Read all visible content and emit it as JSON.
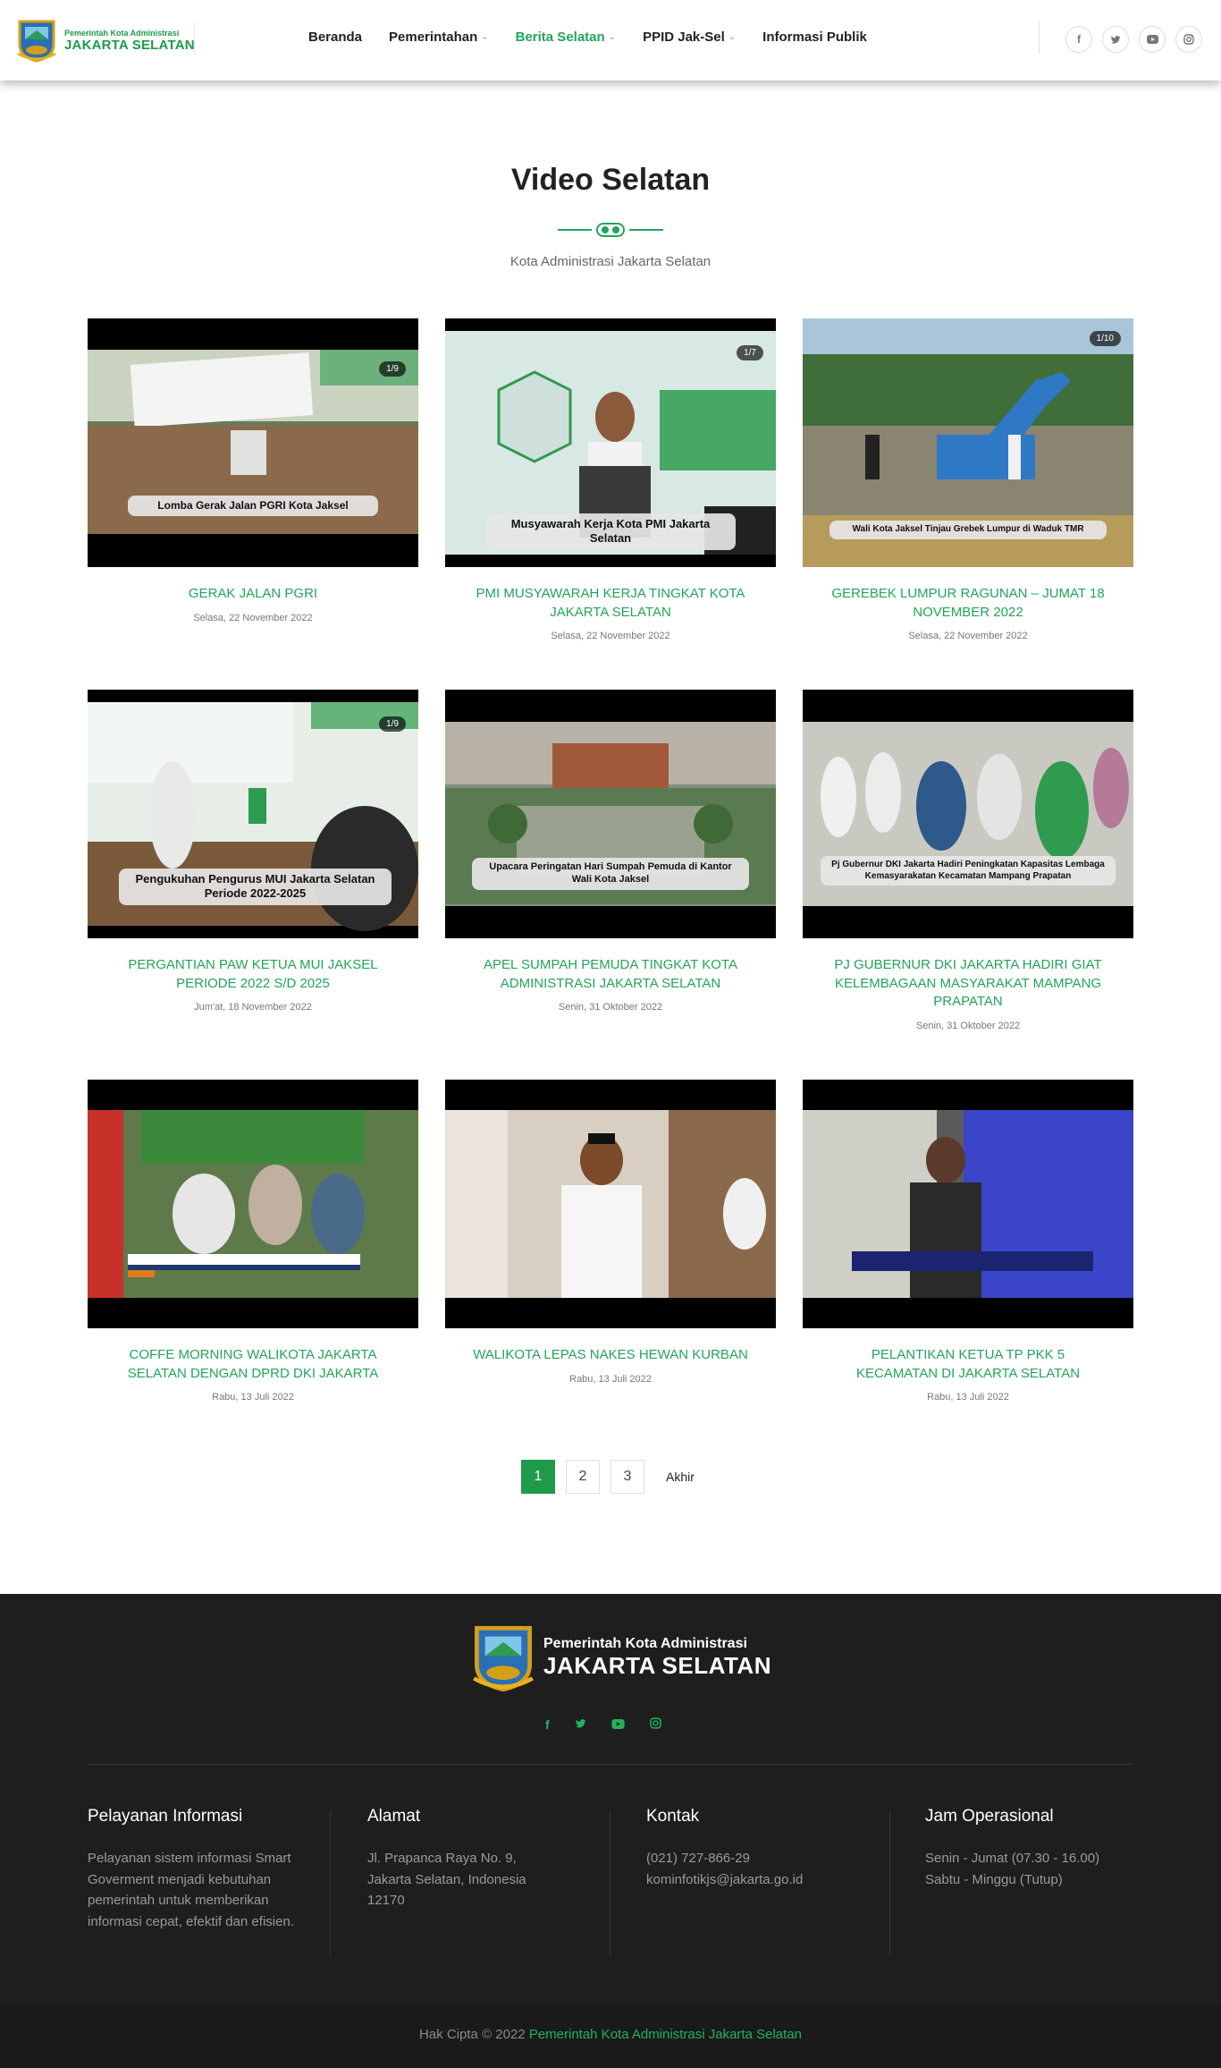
{
  "header": {
    "logo_small": "Pemerintah Kota Administrasi",
    "logo_big": "JAKARTA SELATAN",
    "nav": [
      {
        "label": "Beranda",
        "dropdown": false,
        "active": false
      },
      {
        "label": "Pemerintahan",
        "dropdown": true,
        "active": false
      },
      {
        "label": "Berita Selatan",
        "dropdown": true,
        "active": true
      },
      {
        "label": "PPID Jak-Sel",
        "dropdown": true,
        "active": false
      },
      {
        "label": "Informasi Publik",
        "dropdown": false,
        "active": false
      }
    ],
    "social_icons": [
      "facebook-icon",
      "twitter-icon",
      "youtube-icon",
      "instagram-icon"
    ]
  },
  "section": {
    "title": "Video Selatan",
    "subtitle": "Kota Administrasi Jakarta Selatan"
  },
  "videos": [
    {
      "title": "GERAK JALAN PGRI",
      "date": "Selasa, 22 November 2022",
      "overlay": "Lomba Gerak Jalan PGRI Kota Jaksel",
      "counter": "1/9"
    },
    {
      "title": "PMI MUSYAWARAH KERJA TINGKAT KOTA JAKARTA SELATAN",
      "date": "Selasa, 22 November 2022",
      "overlay": "Musyawarah Kerja Kota PMI Jakarta Selatan",
      "counter": "1/7"
    },
    {
      "title": "GEREBEK LUMPUR RAGUNAN – JUMAT 18 NOVEMBER 2022",
      "date": "Selasa, 22 November 2022",
      "overlay": "Wali Kota Jaksel Tinjau Grebek Lumpur di Waduk TMR",
      "counter": "1/10"
    },
    {
      "title": "PERGANTIAN PAW KETUA MUI JAKSEL PERIODE 2022 S/D 2025",
      "date": "Jum'at, 18 November 2022",
      "overlay": "Pengukuhan Pengurus MUI Jakarta Selatan Periode 2022-2025",
      "counter": "1/9"
    },
    {
      "title": "APEL SUMPAH PEMUDA TINGKAT KOTA ADMINISTRASI JAKARTA SELATAN",
      "date": "Senin, 31 Oktober 2022",
      "overlay": "Upacara Peringatan Hari Sumpah Pemuda di Kantor Wali Kota Jaksel",
      "counter": ""
    },
    {
      "title": "PJ GUBERNUR DKI JAKARTA HADIRI GIAT KELEMBAGAAN MASYARAKAT MAMPANG PRAPATAN",
      "date": "Senin, 31 Oktober 2022",
      "overlay": "Pj Gubernur DKI Jakarta Hadiri Peningkatan Kapasitas Lembaga Kemasyarakatan Kecamatan Mampang Prapatan",
      "counter": ""
    },
    {
      "title": "COFFE MORNING WALIKOTA JAKARTA SELATAN DENGAN DPRD DKI JAKARTA",
      "date": "Rabu, 13 Juli 2022",
      "overlay": "",
      "counter": ""
    },
    {
      "title": "WALIKOTA LEPAS NAKES HEWAN KURBAN",
      "date": "Rabu, 13 Juli 2022",
      "overlay": "",
      "counter": ""
    },
    {
      "title": "PELANTIKAN KETUA TP PKK 5 KECAMATAN DI JAKARTA SELATAN",
      "date": "Rabu, 13 Juli 2022",
      "overlay": "",
      "counter": ""
    }
  ],
  "pagination": {
    "pages": [
      "1",
      "2",
      "3"
    ],
    "current": "1",
    "last_label": "Akhir"
  },
  "footer": {
    "logo_small": "Pemerintah Kota Administrasi",
    "logo_big": "JAKARTA SELATAN",
    "columns": [
      {
        "heading": "Pelayanan Informasi",
        "text": "Pelayanan sistem informasi Smart Goverment menjadi kebutuhan pemerintah untuk memberikan informasi cepat, efektif dan efisien."
      },
      {
        "heading": "Alamat",
        "text": "Jl. Prapanca Raya No. 9, Jakarta Selatan, Indonesia 12170"
      },
      {
        "heading": "Kontak",
        "text": "(021) 727-866-29 kominfotikjs@jakarta.go.id"
      },
      {
        "heading": "Jam Operasional",
        "text": "Senin - Jumat (07.30 - 16.00) Sabtu - Minggu (Tutup)"
      }
    ],
    "copyright_prefix": "Hak Cipta © 2022",
    "copyright_link": "Pemerintah Kota Administrasi Jakarta Selatan"
  },
  "colors": {
    "accent": "#22a55a",
    "footer_bg": "#1e1e1e"
  }
}
